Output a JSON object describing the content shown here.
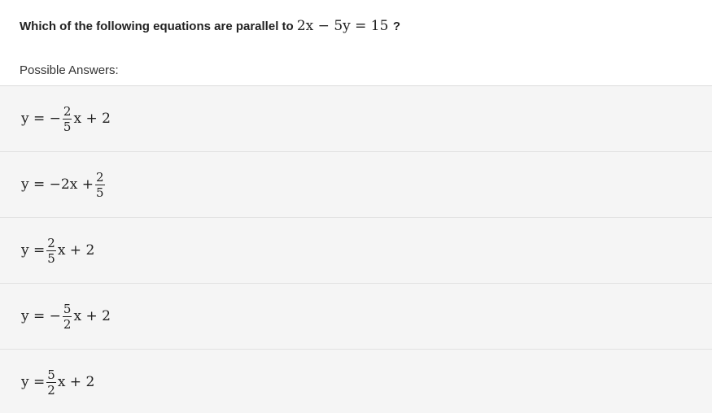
{
  "question": {
    "text_before": "Which of the following equations are parallel to",
    "equation": "2x − 5y = 15",
    "text_after": "?"
  },
  "possible_answers_label": "Possible Answers:",
  "answers": [
    {
      "prefix": "y = −",
      "frac_num": "2",
      "frac_den": "5",
      "suffix": "x + 2",
      "text": "y = −(2/5)x + 2"
    },
    {
      "prefix": "y = −2x + ",
      "frac_num": "2",
      "frac_den": "5",
      "suffix": "",
      "text": "y = −2x + 2/5"
    },
    {
      "prefix": "y = ",
      "frac_num": "2",
      "frac_den": "5",
      "suffix": "x + 2",
      "text": "y = (2/5)x + 2"
    },
    {
      "prefix": "y = −",
      "frac_num": "5",
      "frac_den": "2",
      "suffix": "x + 2",
      "text": "y = −(5/2)x + 2"
    },
    {
      "prefix": "y = ",
      "frac_num": "5",
      "frac_den": "2",
      "suffix": "x + 2",
      "text": "y = (5/2)x + 2"
    }
  ]
}
